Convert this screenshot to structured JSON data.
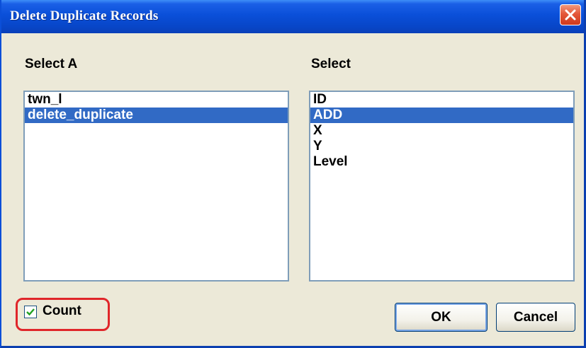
{
  "window": {
    "title": "Delete Duplicate Records"
  },
  "left_panel": {
    "label": "Select A",
    "items": [
      {
        "label": "twn_l",
        "selected": false
      },
      {
        "label": "delete_duplicate",
        "selected": true
      }
    ]
  },
  "right_panel": {
    "label": "Select",
    "items": [
      {
        "label": "ID",
        "selected": false
      },
      {
        "label": "ADD",
        "selected": true
      },
      {
        "label": "X",
        "selected": false
      },
      {
        "label": "Y",
        "selected": false
      },
      {
        "label": "Level",
        "selected": false
      }
    ]
  },
  "count_checkbox": {
    "label": "Count",
    "checked": true
  },
  "buttons": {
    "ok": "OK",
    "cancel": "Cancel"
  },
  "colors": {
    "title_bar": "#0a4fd9",
    "selection": "#316ac5",
    "highlight_outline": "#e0262a",
    "close_button": "#e4573a",
    "check_mark": "#21a121"
  },
  "icons": {
    "close": "close-icon",
    "check": "check-icon"
  }
}
